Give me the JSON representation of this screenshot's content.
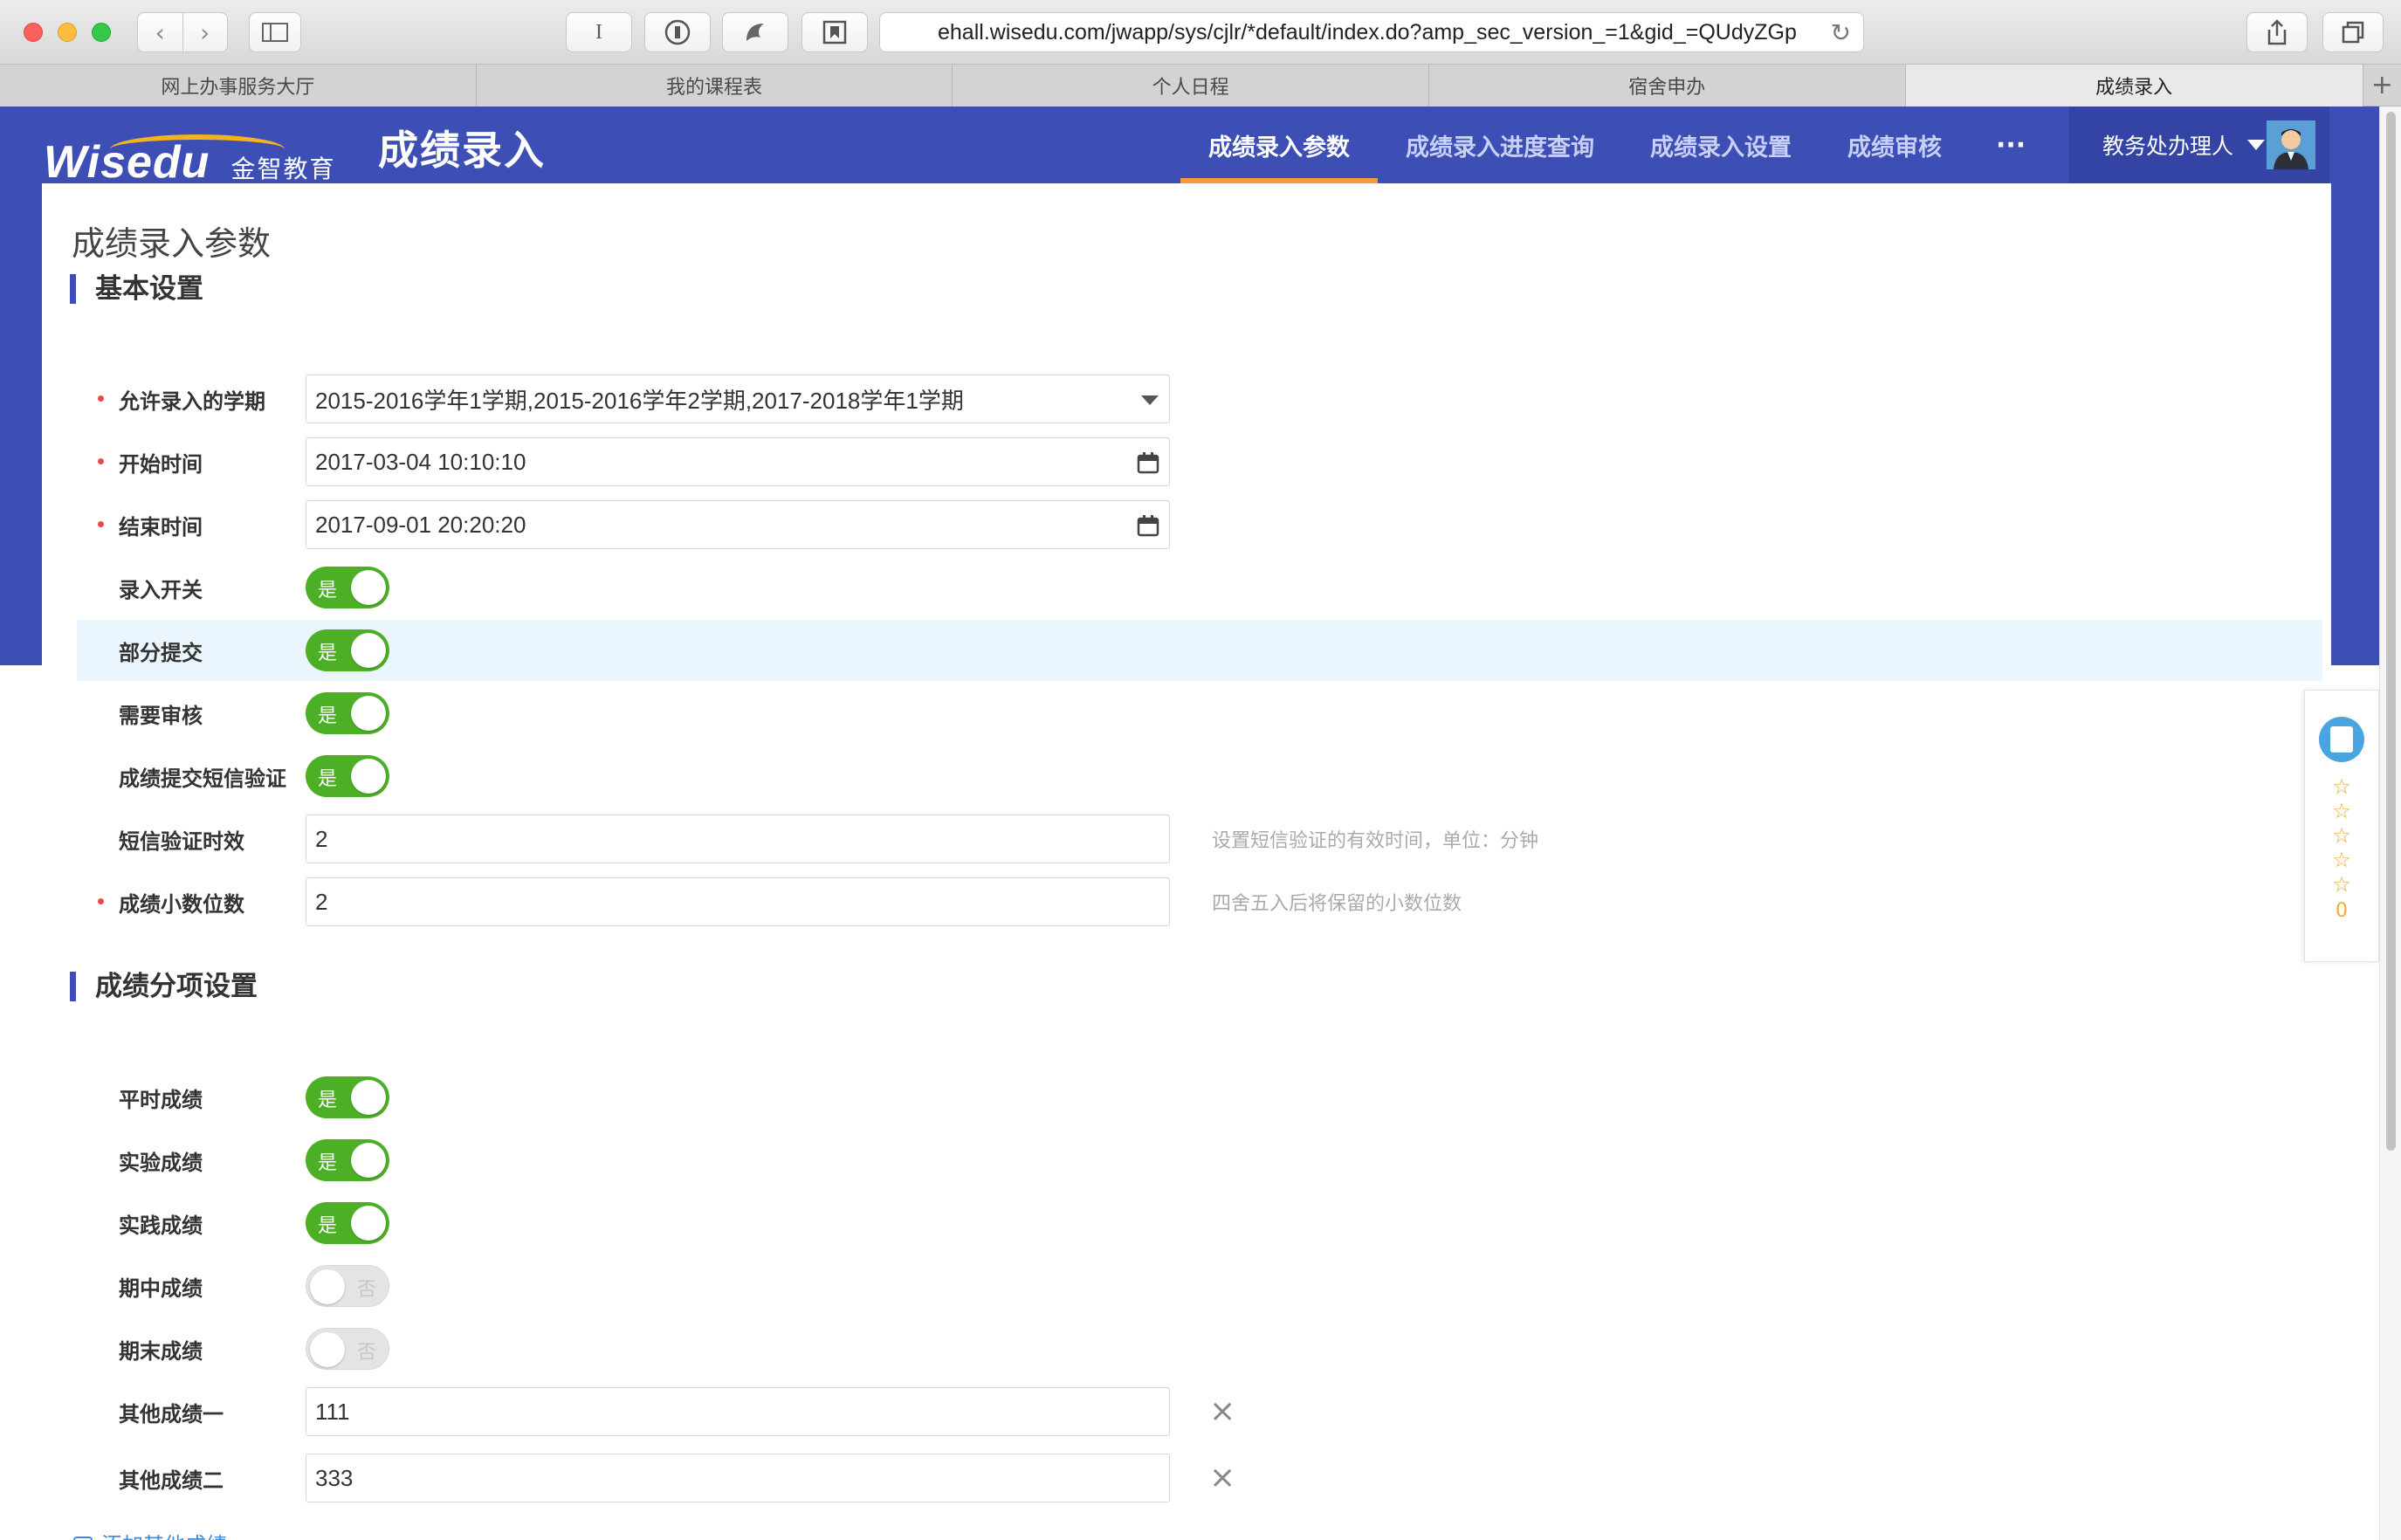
{
  "browser": {
    "url": "ehall.wisedu.com/jwapp/sys/cjlr/*default/index.do?amp_sec_version_=1&gid_=QUdyZGp",
    "tabs": [
      {
        "label": "网上办事服务大厅",
        "active": false
      },
      {
        "label": "我的课程表",
        "active": false
      },
      {
        "label": "个人日程",
        "active": false
      },
      {
        "label": "宿舍申办",
        "active": false
      },
      {
        "label": "成绩录入",
        "active": true
      }
    ]
  },
  "header": {
    "logo_en": "Wisedu",
    "logo_cn": "金智教育",
    "app_title": "成绩录入",
    "nav": [
      {
        "label": "成绩录入参数",
        "active": true
      },
      {
        "label": "成绩录入进度查询",
        "active": false
      },
      {
        "label": "成绩录入设置",
        "active": false
      },
      {
        "label": "成绩审核",
        "active": false
      }
    ],
    "more": "···",
    "user": "教务处办理人"
  },
  "page": {
    "title": "成绩录入参数",
    "basic": {
      "heading": "基本设置",
      "term_label": "允许录入的学期",
      "term_value": "2015-2016学年1学期,2015-2016学年2学期,2017-2018学年1学期",
      "start_label": "开始时间",
      "start_value": "2017-03-04 10:10:10",
      "end_label": "结束时间",
      "end_value": "2017-09-01 20:20:20",
      "entry_switch_label": "录入开关",
      "partial_submit_label": "部分提交",
      "need_review_label": "需要审核",
      "sms_verify_label": "成绩提交短信验证",
      "sms_expiry_label": "短信验证时效",
      "sms_expiry_value": "2",
      "sms_expiry_hint": "设置短信验证的有效时间，单位：分钟",
      "decimals_label": "成绩小数位数",
      "decimals_value": "2",
      "decimals_hint": "四舍五入后将保留的小数位数"
    },
    "items": {
      "heading": "成绩分项设置",
      "usual_label": "平时成绩",
      "lab_label": "实验成绩",
      "practice_label": "实践成绩",
      "midterm_label": "期中成绩",
      "final_label": "期末成绩",
      "other1_label": "其他成绩一",
      "other1_value": "111",
      "other2_label": "其他成绩二",
      "other2_value": "333",
      "add_other": "添加其他成绩"
    },
    "switch_on": "是",
    "switch_off": "否"
  },
  "rating": {
    "score": "0"
  },
  "colors": {
    "primary": "#3d4fb5",
    "accent": "#f79a3e",
    "switch_on": "#4caf26"
  }
}
